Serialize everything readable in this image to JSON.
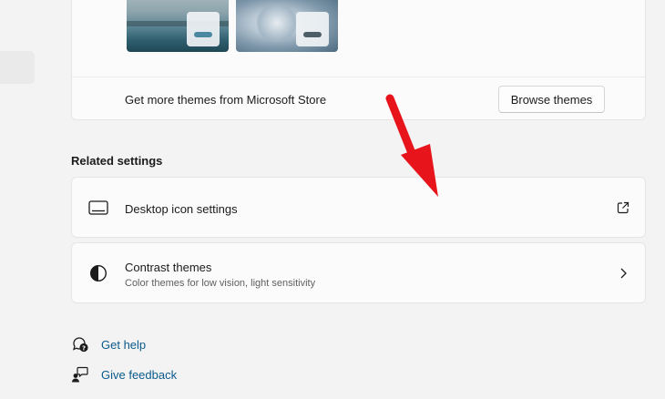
{
  "themes": {
    "store_text": "Get more themes from Microsoft Store",
    "browse_label": "Browse themes"
  },
  "related": {
    "heading": "Related settings",
    "desktop_icon_settings": {
      "title": "Desktop icon settings",
      "icon": "monitor-icon",
      "trailing_icon": "external-link-icon"
    },
    "contrast_themes": {
      "title": "Contrast themes",
      "subtitle": "Color themes for low vision, light sensitivity",
      "icon": "contrast-icon",
      "trailing_icon": "chevron-right-icon"
    }
  },
  "links": {
    "get_help": "Get help",
    "give_feedback": "Give feedback"
  },
  "colors": {
    "accent_link": "#0a5a8c",
    "annotation_arrow": "#e8141c",
    "card_background": "#fbfbfb",
    "page_background": "#f3f3f3"
  }
}
